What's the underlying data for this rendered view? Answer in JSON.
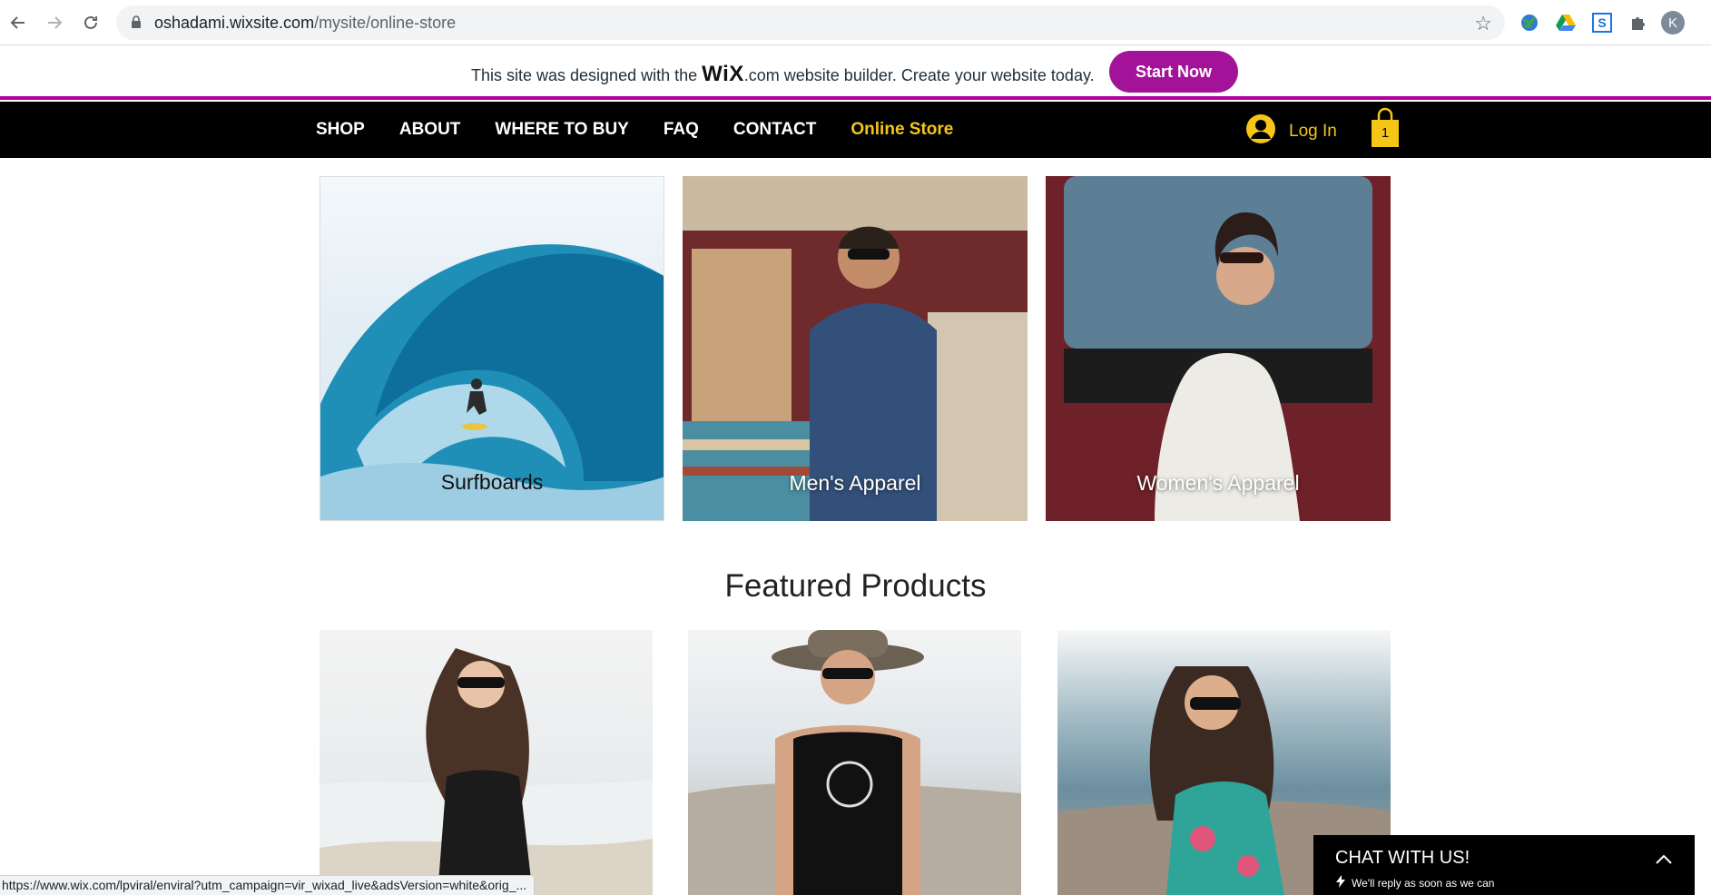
{
  "browser": {
    "url_host": "oshadami.wixsite.com",
    "url_path": "/mysite/online-store",
    "profile_initial": "K",
    "extensions": [
      "globe-extension-icon",
      "google-drive-icon",
      "s-extension-icon",
      "puzzle-extensions-icon"
    ]
  },
  "wix_banner": {
    "text_before": "This site was designed with the",
    "logo": "WiX",
    "text_after": ".com website builder. Create your website today.",
    "button": "Start Now",
    "accent_color": "#a3139a"
  },
  "header": {
    "menu": [
      "SHOP",
      "ABOUT",
      "WHERE TO BUY",
      "FAQ",
      "CONTACT",
      "Online Store"
    ],
    "active_item": "Online Store",
    "login_label": "Log In",
    "cart_count": "1",
    "accent_color": "#f5c518"
  },
  "categories": [
    {
      "label": "Surfboards"
    },
    {
      "label": "Men's Apparel"
    },
    {
      "label": "Women's Apparel"
    }
  ],
  "featured": {
    "title": "Featured Products"
  },
  "chat": {
    "title": "CHAT WITH US!",
    "subtitle": "We'll reply as soon as we can"
  },
  "status_bar": {
    "url": "https://www.wix.com/lpviral/enviral?utm_campaign=vir_wixad_live&adsVersion=white&orig_..."
  }
}
